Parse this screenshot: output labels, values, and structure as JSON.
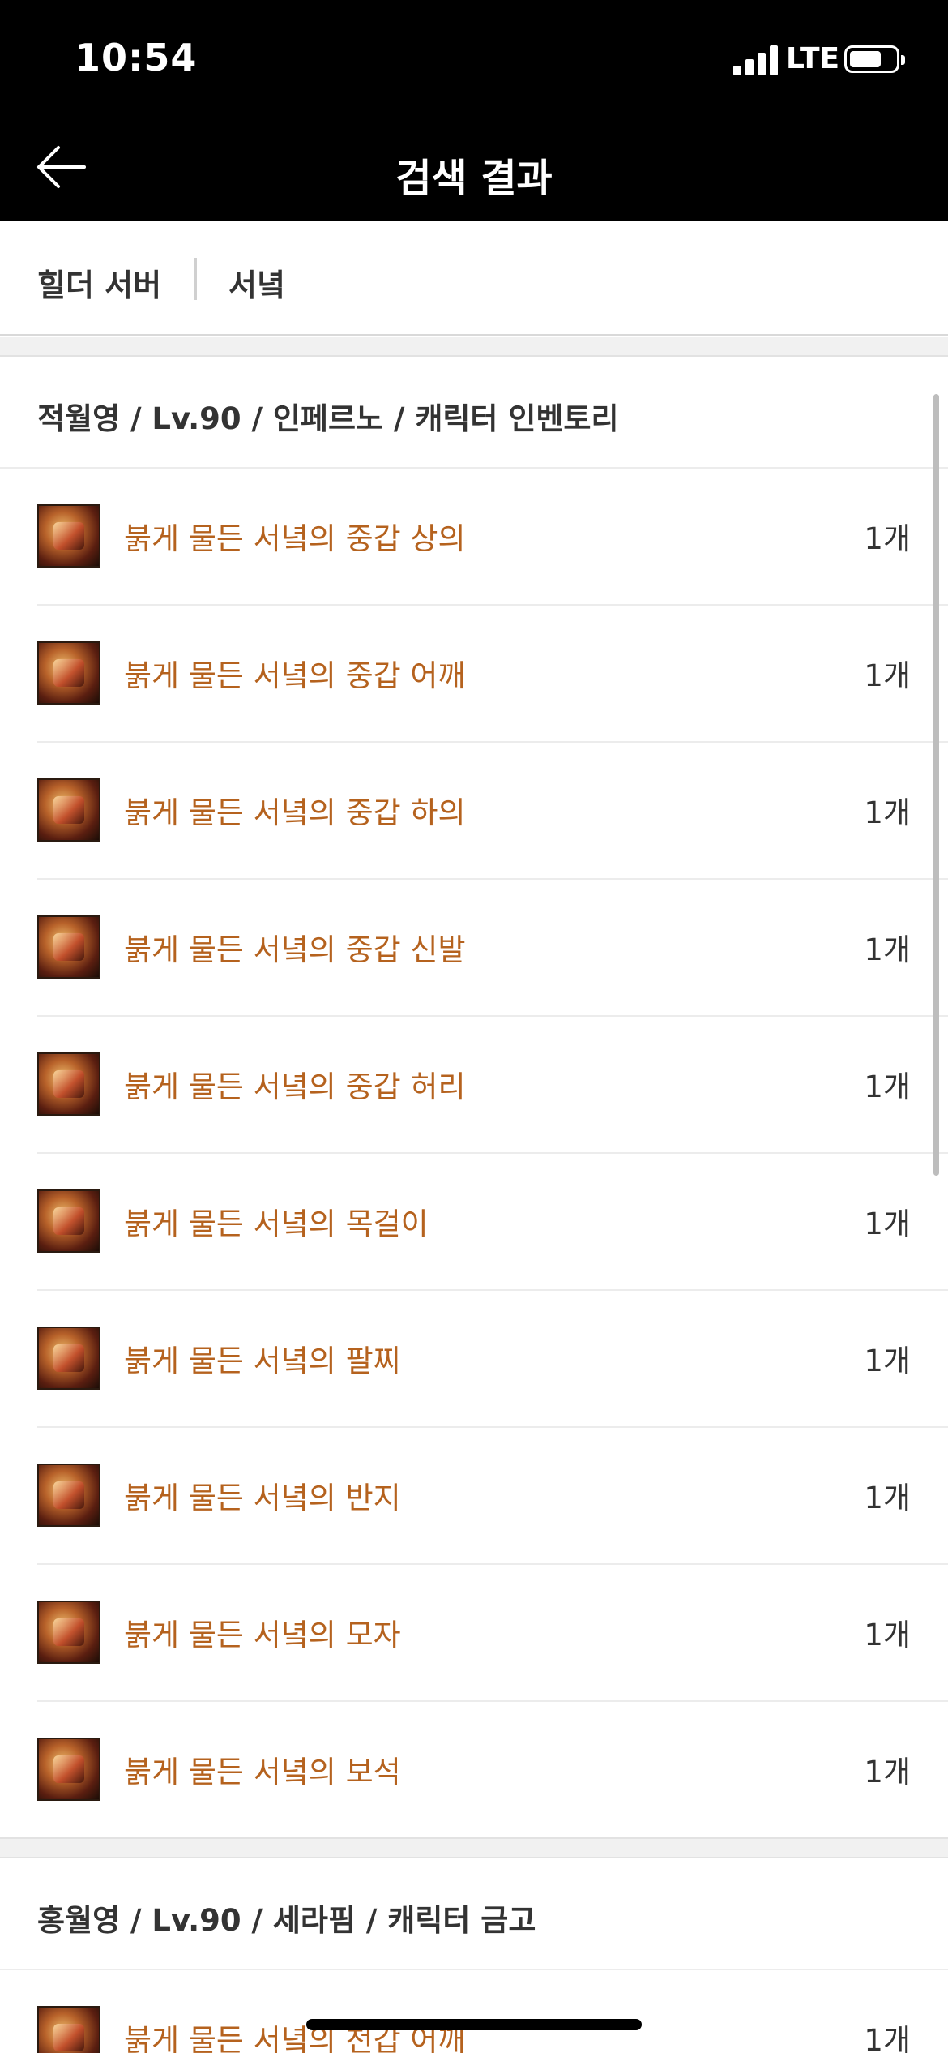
{
  "status": {
    "time": "10:54",
    "network": "LTE"
  },
  "header": {
    "title": "검색 결과",
    "back_icon": "arrow-left-icon"
  },
  "filter": {
    "server": "힐더 서버",
    "keyword": "서녘"
  },
  "results": [
    {
      "title": "적월영 / Lv.90 / 인페르노 / 캐릭터 인벤토리",
      "items": [
        {
          "name": "붉게 물든 서녘의 중갑 상의",
          "count": "1개"
        },
        {
          "name": "붉게 물든 서녘의 중갑 어깨",
          "count": "1개"
        },
        {
          "name": "붉게 물든 서녘의 중갑 하의",
          "count": "1개"
        },
        {
          "name": "붉게 물든 서녘의 중갑 신발",
          "count": "1개"
        },
        {
          "name": "붉게 물든 서녘의 중갑 허리",
          "count": "1개"
        },
        {
          "name": "붉게 물든 서녘의 목걸이",
          "count": "1개"
        },
        {
          "name": "붉게 물든 서녘의 팔찌",
          "count": "1개"
        },
        {
          "name": "붉게 물든 서녘의 반지",
          "count": "1개"
        },
        {
          "name": "붉게 물든 서녘의 모자",
          "count": "1개"
        },
        {
          "name": "붉게 물든 서녘의 보석",
          "count": "1개"
        }
      ]
    },
    {
      "title": "홍월영 / Lv.90 / 세라핌 / 캐릭터 금고",
      "items": [
        {
          "name": "붉게 물든 서녘의 천갑 어깨",
          "count": "1개"
        }
      ]
    }
  ],
  "colors": {
    "item_name": "#b5621e",
    "header_bg": "#000000"
  }
}
